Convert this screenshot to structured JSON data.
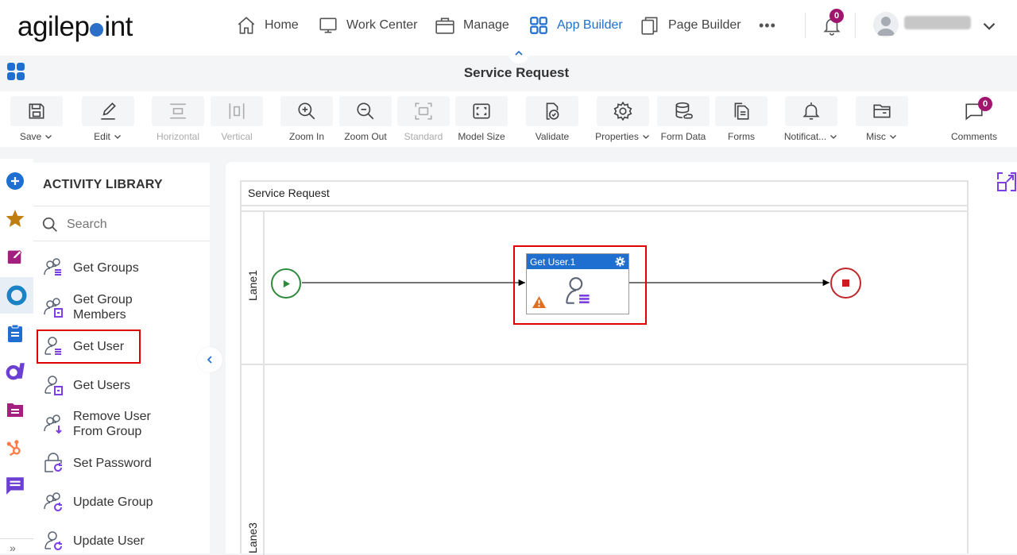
{
  "brand": {
    "logo_text_left": "agilep",
    "logo_text_right": "int"
  },
  "topnav": {
    "items": [
      {
        "label": "Home",
        "icon": "home-icon"
      },
      {
        "label": "Work Center",
        "icon": "monitor-icon"
      },
      {
        "label": "Manage",
        "icon": "briefcase-icon"
      },
      {
        "label": "App Builder",
        "icon": "grid-icon",
        "active": true
      },
      {
        "label": "Page Builder",
        "icon": "pages-icon"
      }
    ],
    "more_label": "•••",
    "notifications_count": "0"
  },
  "titlebar": {
    "title": "Service Request"
  },
  "toolbar": {
    "buttons": [
      {
        "label": "Save",
        "dropdown": true,
        "enabled": true
      },
      {
        "label": "Edit",
        "dropdown": true,
        "enabled": true
      },
      {
        "label": "Horizontal",
        "enabled": false
      },
      {
        "label": "Vertical",
        "enabled": false
      },
      {
        "label": "Zoom In",
        "enabled": true
      },
      {
        "label": "Zoom Out",
        "enabled": true
      },
      {
        "label": "Standard",
        "enabled": false
      },
      {
        "label": "Model Size",
        "enabled": true
      },
      {
        "label": "Validate",
        "enabled": true
      },
      {
        "label": "Properties",
        "dropdown": true,
        "enabled": true
      },
      {
        "label": "Form Data",
        "enabled": true
      },
      {
        "label": "Forms",
        "enabled": true
      },
      {
        "label": "Notificat...",
        "dropdown": true,
        "enabled": true
      },
      {
        "label": "Misc",
        "dropdown": true,
        "enabled": true
      },
      {
        "label": "Comments",
        "enabled": true,
        "count": "0"
      }
    ]
  },
  "library": {
    "title": "ACTIVITY LIBRARY",
    "search_placeholder": "Search",
    "items": [
      {
        "label": "Get Groups"
      },
      {
        "label": "Get Group Members"
      },
      {
        "label": "Get User",
        "highlighted": true
      },
      {
        "label": "Get Users"
      },
      {
        "label": "Remove User From Group"
      },
      {
        "label": "Set Password"
      },
      {
        "label": "Update Group"
      },
      {
        "label": "Update User"
      }
    ]
  },
  "leftrail": {
    "icons": [
      "add-icon",
      "favorites-star-icon",
      "edit-form-icon",
      "agilepoint-circle-icon",
      "clipboard-icon",
      "salesforce-a-icon",
      "folder-doc-icon",
      "hubspot-icon",
      "chat-icon"
    ],
    "expand_label": "»"
  },
  "canvas": {
    "pool_title": "Service Request",
    "lanes": [
      "Lane1",
      "Lane3"
    ],
    "task": {
      "title": "Get User.1",
      "has_warning": true
    },
    "colors": {
      "task_header": "#1f6fd1",
      "start": "#2e8b3e",
      "end": "#c0282b",
      "highlight": "#e00000",
      "warning": "#e07020"
    }
  }
}
